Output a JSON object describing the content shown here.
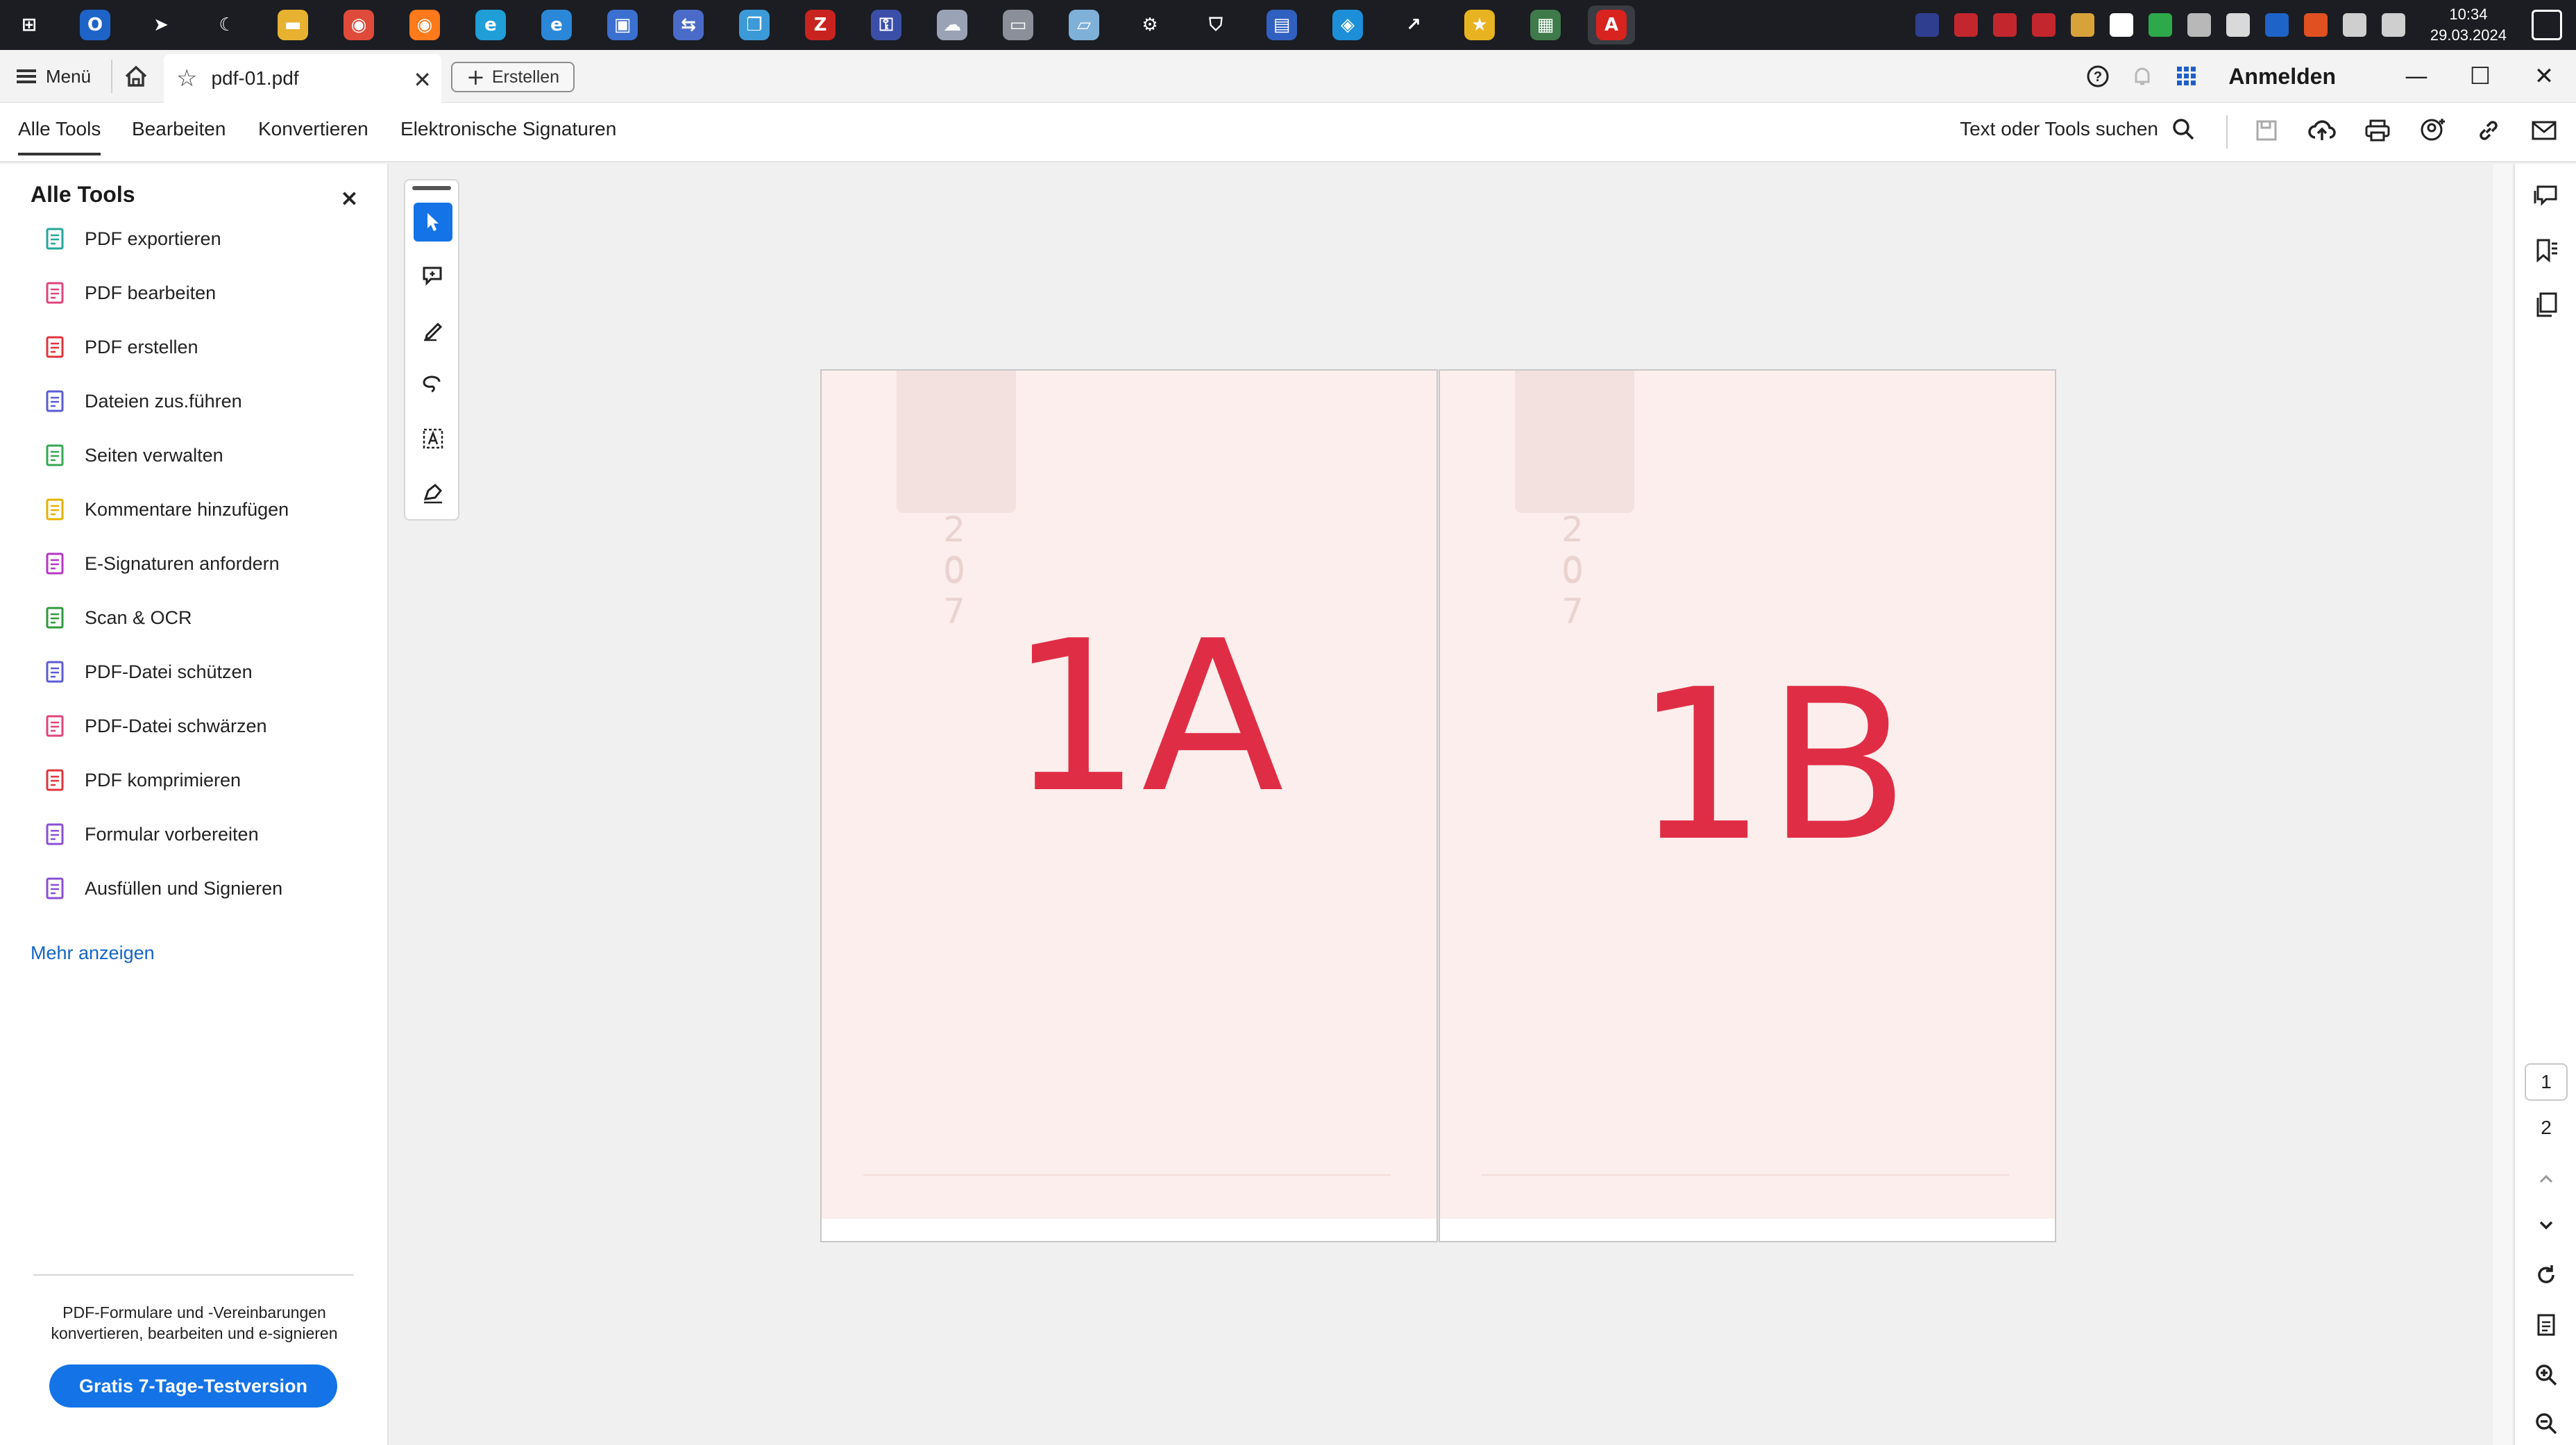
{
  "taskbar": {
    "apps": [
      {
        "name": "windows-start-icon",
        "color": "#1b1d22",
        "glyph": "⊞"
      },
      {
        "name": "outlook-icon",
        "color": "#1e63c8",
        "glyph": "O"
      },
      {
        "name": "telegram-icon",
        "color": "#1b1d22",
        "glyph": "➤"
      },
      {
        "name": "moon-app-icon",
        "color": "#1b1d22",
        "glyph": "☾"
      },
      {
        "name": "file-explorer-icon",
        "color": "#e7b230",
        "glyph": "▬"
      },
      {
        "name": "chrome-icon",
        "color": "#e04a3a",
        "glyph": "◉"
      },
      {
        "name": "firefox-icon",
        "color": "#ff7a1a",
        "glyph": "◉"
      },
      {
        "name": "edge-icon",
        "color": "#1f9ed8",
        "glyph": "e"
      },
      {
        "name": "internet-explorer-icon",
        "color": "#2b87d8",
        "glyph": "e"
      },
      {
        "name": "remote-desktop-icon",
        "color": "#3b6fd0",
        "glyph": "▣"
      },
      {
        "name": "network-app-icon",
        "color": "#4b6bc8",
        "glyph": "⇆"
      },
      {
        "name": "copy-app-icon",
        "color": "#3c9ad8",
        "glyph": "❐"
      },
      {
        "name": "filezilla-icon",
        "color": "#c8231f",
        "glyph": "Z"
      },
      {
        "name": "keepass-icon",
        "color": "#3b4fa8",
        "glyph": "⚿"
      },
      {
        "name": "cloud-app-icon",
        "color": "#9aa3b5",
        "glyph": "☁"
      },
      {
        "name": "scanner-app-icon",
        "color": "#8a8f99",
        "glyph": "▭"
      },
      {
        "name": "notes-app-icon",
        "color": "#7fb0d8",
        "glyph": "▱"
      },
      {
        "name": "settings-icon",
        "color": "#1b1d22",
        "glyph": "⚙"
      },
      {
        "name": "security-shield-icon",
        "color": "#1b1d22",
        "glyph": "⛉"
      },
      {
        "name": "document-app-icon",
        "color": "#3060c0",
        "glyph": "▤"
      },
      {
        "name": "teamviewer-icon",
        "color": "#1d8fd8",
        "glyph": "◈"
      },
      {
        "name": "green-arrow-app-icon",
        "color": "#1b1d22",
        "glyph": "↗"
      },
      {
        "name": "favorites-app-icon",
        "color": "#e8b320",
        "glyph": "★"
      },
      {
        "name": "terminal-app-icon",
        "color": "#3e7a4a",
        "glyph": "▦"
      },
      {
        "name": "acrobat-icon",
        "color": "#d8231f",
        "glyph": "A"
      }
    ],
    "clock_time": "10:34",
    "clock_date": "29.03.2024"
  },
  "titlebar": {
    "menu_label": "Menü",
    "tab_title": "pdf-01.pdf",
    "create_label": "Erstellen",
    "signin_label": "Anmelden",
    "minimize": "—",
    "maximize": "☐",
    "close": "✕"
  },
  "toolbar": {
    "tabs": [
      "Alle Tools",
      "Bearbeiten",
      "Konvertieren",
      "Elektronische Signaturen"
    ],
    "search_label": "Text oder Tools suchen"
  },
  "leftpanel": {
    "title": "Alle Tools",
    "close": "×",
    "tools": [
      {
        "label": "PDF exportieren",
        "icon": "export-pdf-icon",
        "color": "#26a69a"
      },
      {
        "label": "PDF bearbeiten",
        "icon": "edit-pdf-icon",
        "color": "#e0457b"
      },
      {
        "label": "PDF erstellen",
        "icon": "create-pdf-icon",
        "color": "#e0343c"
      },
      {
        "label": "Dateien zus.führen",
        "icon": "combine-files-icon",
        "color": "#5b5bd6"
      },
      {
        "label": "Seiten verwalten",
        "icon": "organize-pages-icon",
        "color": "#34a853"
      },
      {
        "label": "Kommentare hinzufügen",
        "icon": "comment-icon",
        "color": "#e6b000"
      },
      {
        "label": "E-Signaturen anfordern",
        "icon": "request-esign-icon",
        "color": "#b637c4"
      },
      {
        "label": "Scan & OCR",
        "icon": "scan-ocr-icon",
        "color": "#2e9a3e"
      },
      {
        "label": "PDF-Datei schützen",
        "icon": "protect-pdf-icon",
        "color": "#5b5bd6"
      },
      {
        "label": "PDF-Datei schwärzen",
        "icon": "redact-pdf-icon",
        "color": "#e0457b"
      },
      {
        "label": "PDF komprimieren",
        "icon": "compress-pdf-icon",
        "color": "#e0343c"
      },
      {
        "label": "Formular vorbereiten",
        "icon": "prepare-form-icon",
        "color": "#8a4fd6"
      },
      {
        "label": "Ausfüllen und Signieren",
        "icon": "fill-sign-icon",
        "color": "#8a4fd6"
      }
    ],
    "more_label": "Mehr anzeigen",
    "promo_line1": "PDF-Formulare und -Vereinbarungen",
    "promo_line2": "konvertieren, bearbeiten und e-signieren",
    "trial_label": "Gratis 7-Tage-Testversion"
  },
  "document": {
    "pages": [
      {
        "handwriting": "1A",
        "watermark_top": "2 0",
        "watermark_bottom": "0 7"
      },
      {
        "handwriting": "1B",
        "watermark_top": "2 0",
        "watermark_bottom": "0 7"
      }
    ]
  },
  "rightrail": {
    "pages": [
      "1",
      "2"
    ]
  }
}
